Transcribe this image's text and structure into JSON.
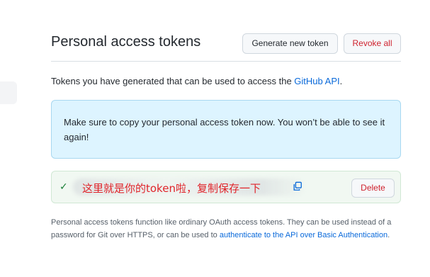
{
  "header": {
    "title": "Personal access tokens",
    "generate_label": "Generate new token",
    "revoke_label": "Revoke all"
  },
  "intro": {
    "text": "Tokens you have generated that can be used to access the ",
    "link": "GitHub API",
    "suffix": "."
  },
  "flash": {
    "message": "Make sure to copy your personal access token now. You won’t be able to see it again!"
  },
  "token": {
    "annotation": "这里就是你的token啦，复制保存一下",
    "delete_label": "Delete",
    "icons": [
      "check-icon",
      "copy-icon"
    ]
  },
  "footer": {
    "text": "Personal access tokens function like ordinary OAuth access tokens. They can be used instead of a password for Git over HTTPS, or can be used to ",
    "link": "authenticate to the API over Basic Authentication",
    "suffix": "."
  },
  "colors": {
    "link": "#0969da",
    "danger": "#cf222e",
    "flash_bg": "#ddf4ff",
    "success_bg": "#f1f8f2",
    "success": "#1a7f37",
    "annotation": "#e0242a"
  }
}
